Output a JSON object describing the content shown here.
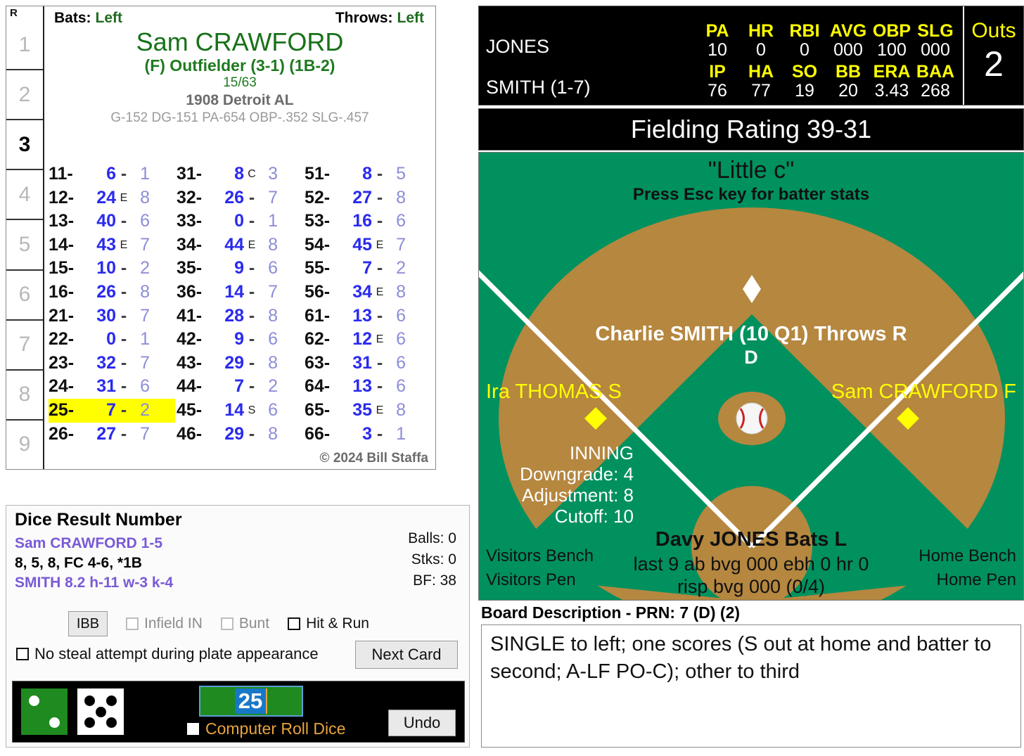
{
  "card": {
    "bats_label": "Bats:",
    "bats_value": "Left",
    "throws_label": "Throws:",
    "throws_value": "Left",
    "player_name": "Sam CRAWFORD",
    "position": "(F) Outfielder (3-1) (1B-2)",
    "fraction": "15/63",
    "team": "1908 Detroit AL",
    "stat_line": "G-152 DG-151 PA-654 OBP-.352 SLG-.457",
    "copyright": "© 2024 Bill Staffa",
    "rail_header": "R",
    "innings": [
      "1",
      "2",
      "3",
      "4",
      "5",
      "6",
      "7",
      "8",
      "9"
    ],
    "active_inning": "3"
  },
  "dice_table": {
    "columns": [
      [
        {
          "key": "11-",
          "num": "6",
          "mod": "-",
          "fld": "1"
        },
        {
          "key": "12-",
          "num": "24",
          "mod": "E",
          "fld": "8"
        },
        {
          "key": "13-",
          "num": "40",
          "mod": "-",
          "fld": "6"
        },
        {
          "key": "14-",
          "num": "43",
          "mod": "E",
          "fld": "7"
        },
        {
          "key": "15-",
          "num": "10",
          "mod": "-",
          "fld": "2"
        },
        {
          "key": "16-",
          "num": "26",
          "mod": "-",
          "fld": "8"
        },
        {
          "key": "21-",
          "num": "30",
          "mod": "-",
          "fld": "7"
        },
        {
          "key": "22-",
          "num": "0",
          "mod": "-",
          "fld": "1"
        },
        {
          "key": "23-",
          "num": "32",
          "mod": "-",
          "fld": "7"
        },
        {
          "key": "24-",
          "num": "31",
          "mod": "-",
          "fld": "6"
        },
        {
          "key": "25-",
          "num": "7",
          "mod": "-",
          "fld": "2",
          "highlight": true
        },
        {
          "key": "26-",
          "num": "27",
          "mod": "-",
          "fld": "7"
        }
      ],
      [
        {
          "key": "31-",
          "num": "8",
          "mod": "C",
          "fld": "3"
        },
        {
          "key": "32-",
          "num": "26",
          "mod": "-",
          "fld": "7"
        },
        {
          "key": "33-",
          "num": "0",
          "mod": "-",
          "fld": "1"
        },
        {
          "key": "34-",
          "num": "44",
          "mod": "E",
          "fld": "8"
        },
        {
          "key": "35-",
          "num": "9",
          "mod": "-",
          "fld": "6"
        },
        {
          "key": "36-",
          "num": "14",
          "mod": "-",
          "fld": "7"
        },
        {
          "key": "41-",
          "num": "28",
          "mod": "-",
          "fld": "8"
        },
        {
          "key": "42-",
          "num": "9",
          "mod": "-",
          "fld": "6"
        },
        {
          "key": "43-",
          "num": "29",
          "mod": "-",
          "fld": "8"
        },
        {
          "key": "44-",
          "num": "7",
          "mod": "-",
          "fld": "2"
        },
        {
          "key": "45-",
          "num": "14",
          "mod": "S",
          "fld": "6"
        },
        {
          "key": "46-",
          "num": "29",
          "mod": "-",
          "fld": "8"
        }
      ],
      [
        {
          "key": "51-",
          "num": "8",
          "mod": "-",
          "fld": "5"
        },
        {
          "key": "52-",
          "num": "27",
          "mod": "-",
          "fld": "8"
        },
        {
          "key": "53-",
          "num": "16",
          "mod": "-",
          "fld": "6"
        },
        {
          "key": "54-",
          "num": "45",
          "mod": "E",
          "fld": "7"
        },
        {
          "key": "55-",
          "num": "7",
          "mod": "-",
          "fld": "2"
        },
        {
          "key": "56-",
          "num": "34",
          "mod": "E",
          "fld": "8"
        },
        {
          "key": "61-",
          "num": "13",
          "mod": "-",
          "fld": "6"
        },
        {
          "key": "62-",
          "num": "12",
          "mod": "E",
          "fld": "6"
        },
        {
          "key": "63-",
          "num": "31",
          "mod": "-",
          "fld": "6"
        },
        {
          "key": "64-",
          "num": "13",
          "mod": "-",
          "fld": "6"
        },
        {
          "key": "65-",
          "num": "35",
          "mod": "E",
          "fld": "8"
        },
        {
          "key": "66-",
          "num": "3",
          "mod": "-",
          "fld": "1"
        }
      ]
    ]
  },
  "drn": {
    "title": "Dice Result Number",
    "line1": "Sam CRAWFORD  1-5",
    "line2": "8, 5, 8, FC 4-6, *1B",
    "line3": "SMITH  8.2  h-11  w-3  k-4",
    "balls": "Balls: 0",
    "strikes": "Stks: 0",
    "bf": "BF: 38",
    "ibb_label": "IBB",
    "infield_in_label": "Infield IN",
    "bunt_label": "Bunt",
    "hit_and_run_label": "Hit & Run",
    "no_steal_label": "No steal attempt during plate appearance",
    "next_card_label": "Next Card",
    "computer_roll_label": "Computer Roll Dice",
    "undo_label": "Undo",
    "roll_value": "25",
    "die_green_value": 2,
    "die_white_value": 5
  },
  "scoreboard": {
    "batter_name": "JONES",
    "batter_headers": [
      "PA",
      "HR",
      "RBI",
      "AVG",
      "OBP",
      "SLG"
    ],
    "batter_values": [
      "10",
      "0",
      "0",
      "000",
      "100",
      "000"
    ],
    "pitcher_name": "SMITH (1-7)",
    "pitcher_headers": [
      "IP",
      "HA",
      "SO",
      "BB",
      "ERA",
      "BAA"
    ],
    "pitcher_values": [
      "76",
      "77",
      "19",
      "20",
      "3.43",
      "268"
    ],
    "outs_label": "Outs",
    "outs_value": "2"
  },
  "field": {
    "fielding_rating": "Fielding Rating 39-31",
    "little_c": "\"Little c\"",
    "esc_hint": "Press Esc key for batter stats",
    "pitcher_line": "Charlie SMITH (10 Q1) Throws R",
    "pitcher_sub": "D",
    "fielder_left": "Ira THOMAS S",
    "fielder_right": "Sam CRAWFORD F",
    "inning_title": "INNING",
    "downgrade": "Downgrade: 4",
    "adjustment": "Adjustment: 8",
    "cutoff": "Cutoff: 10",
    "batter_line": "Davy JONES Bats L",
    "batter_sub1": "last 9 ab bvg 000 ebh 0 hr 0",
    "batter_sub2": "risp bvg 000 (0/4)",
    "visitors_bench": "Visitors Bench",
    "visitors_pen": "Visitors Pen",
    "home_bench": "Home Bench",
    "home_pen": "Home Pen"
  },
  "board": {
    "title": "Board Description - PRN: 7 (D) (2)",
    "description": "SINGLE to left; one scores (S out at home and batter to second; A-LF PO-C); other to third"
  },
  "colors": {
    "field_green": "#00915f",
    "infield_dirt": "#b5873f",
    "accent_yellow": "#ffff00",
    "card_green": "#177117",
    "result_blue": "#2a2aee",
    "fielder_purple": "#8d8dd8",
    "highlight": "#ffff00"
  }
}
